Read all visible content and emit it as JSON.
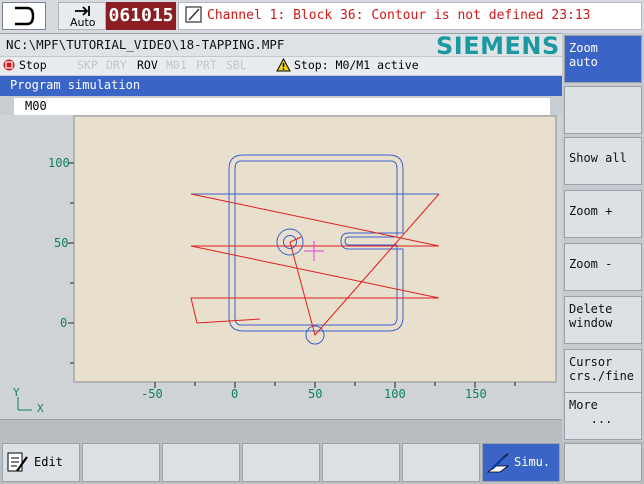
{
  "header": {
    "mode_label": "Auto",
    "program_number": "061015",
    "alarm_text": "Channel 1: Block 36: Contour is not defined 23:13"
  },
  "path_bar": {
    "path": "NC:\\MPF\\TUTORIAL_VIDEO\\18-TAPPING.MPF",
    "brand": "SIEMENS"
  },
  "status_bar": {
    "state": "Stop",
    "flags": [
      "SKP",
      "DRY",
      "ROV",
      "M01",
      "PRT",
      "SBL"
    ],
    "active_flag": "ROV",
    "stop_message": "Stop: M0/M1 active"
  },
  "simulation": {
    "title": "Program simulation",
    "current_block": "M00",
    "axis_y_label": "Y",
    "axis_x_label": "X",
    "x_ticks": [
      "-50",
      "0",
      "50",
      "100",
      "150"
    ],
    "y_ticks": [
      "100",
      "50",
      "0"
    ]
  },
  "vertical_softkeys": [
    {
      "label": "Zoom\nauto",
      "active": true
    },
    {
      "label": "",
      "active": false
    },
    {
      "label": "Show all",
      "active": false
    },
    {
      "label": "Zoom +",
      "active": false
    },
    {
      "label": "Zoom -",
      "active": false
    },
    {
      "label": "Delete\nwindow",
      "active": false
    },
    {
      "label": "Cursor\ncrs./fine",
      "active": false
    },
    {
      "label": "More\n   ...",
      "active": false
    }
  ],
  "horizontal_softkeys": [
    {
      "label": "Edit",
      "icon": "edit-icon",
      "active": false
    },
    {
      "label": "",
      "active": false
    },
    {
      "label": "",
      "active": false
    },
    {
      "label": "",
      "active": false
    },
    {
      "label": "",
      "active": false
    },
    {
      "label": "",
      "active": false
    },
    {
      "label": "Simu.",
      "icon": "simulation-icon",
      "active": true
    },
    {
      "label": "",
      "active": false
    }
  ],
  "colors": {
    "program_bg": "#8b1e22",
    "alarm_text": "#d01818",
    "brand": "#1a9aa0",
    "header_blue": "#3b64c7",
    "toolpath_contour": "#3a5fcd",
    "toolpath_rapid": "#e01e1e",
    "cursor": "#e040e0",
    "axis_text": "#0e8060",
    "plot_bg": "#e8e0cc"
  }
}
